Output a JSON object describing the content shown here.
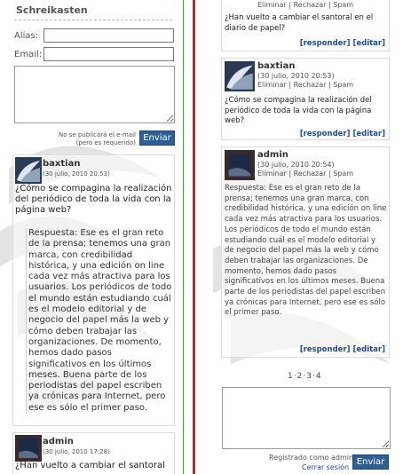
{
  "sidebar": {
    "title": "Schreikasten",
    "alias_label": "Alias:",
    "email_label": "Email:",
    "email_note_line1": "No se publicará el e-mail",
    "email_note_line2": "(pero es requerido)",
    "submit_label": "Enviar",
    "comments": [
      {
        "author": "baxtian",
        "date": "(30 julio, 2010 20:53)",
        "question": "¿Cómo se compagina la realización del periódico de toda la vida con la página web?",
        "answer": "Respuesta: Ese es el gran reto de la prensa; tenemos una gran marca, con credibilidad histórica, y una edición on line cada vez más atractiva para los usuarios. Los periódicos de todo el mundo están estudiando cuál es el modelo editorial y de negocio del papel más la web y cómo deben trabajar las organizaciones. De momento, hemos dado pasos significativos en los últimos meses. Buena parte de los periodistas del papel escriben ya crónicas para Internet, pero ese es sólo el primer paso."
      },
      {
        "author": "admin",
        "date": "(30 julio, 2010 17:28)",
        "question": "¿Han vuelto a cambiar el santoral"
      }
    ]
  },
  "main": {
    "top_card": {
      "links": [
        "Eliminar",
        "Rechazar",
        "Spam"
      ],
      "question": "¿Han vuelto a cambiar el santoral en el diario de papel?",
      "respond": "[responder]",
      "edit": "[editar]"
    },
    "cards": [
      {
        "author": "baxtian",
        "date": "(30 julio, 2010 20:53)",
        "links": [
          "Eliminar",
          "Rechazar",
          "Spam"
        ],
        "question": "¿Cómo se compagina la realización del periódico de toda la vida con la página web?",
        "respond": "[responder]",
        "edit": "[editar]"
      },
      {
        "author": "admin",
        "date": "(30 julio, 2010 20:54)",
        "links": [
          "Eliminar",
          "Rechazar",
          "Spam"
        ],
        "answer": "Respuesta: Ese es el gran reto de la prensa; tenemos una gran marca, con credibilidad histórica, y una edición on line cada vez más atractiva para los usuarios. Los periódicos de todo el mundo están estudiando cuál es el modelo editorial y de negocio del papel más la web y cómo deben trabajar las organizaciones. De momento, hemos dado pasos significativos en los últimos meses. Buena parte de los periodistas del papel escriben ya crónicas para Internet, pero ese es sólo el primer paso.",
        "respond": "[responder]",
        "edit": "[editar]"
      }
    ],
    "pager": [
      "1",
      "2",
      "3",
      "4"
    ],
    "registered_as": "Registrado como admin",
    "logout": "Cerrar sesión",
    "submit_label": "Enviar"
  },
  "colors": {
    "accent": "#2e5f94",
    "divider_red": "#c0272d",
    "divider_green": "#4a9a4a",
    "link": "#1f4a9a"
  }
}
